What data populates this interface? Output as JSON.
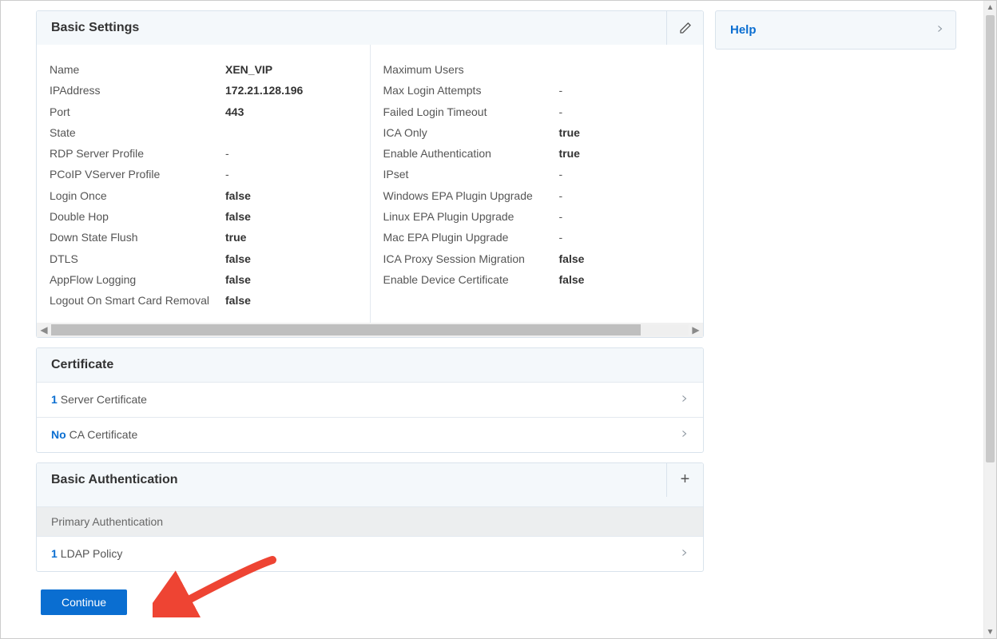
{
  "side": {
    "help_label": "Help"
  },
  "basic_settings": {
    "title": "Basic Settings",
    "left": [
      {
        "label": "Name",
        "value": "XEN_VIP",
        "bold": true
      },
      {
        "label": "IPAddress",
        "value": "172.21.128.196",
        "bold": true
      },
      {
        "label": "Port",
        "value": "443",
        "bold": true
      },
      {
        "label": "State",
        "value": "",
        "bold": false
      },
      {
        "label": "RDP Server Profile",
        "value": "-",
        "bold": false
      },
      {
        "label": "PCoIP VServer Profile",
        "value": "-",
        "bold": false
      },
      {
        "label": "Login Once",
        "value": "false",
        "bold": true
      },
      {
        "label": "Double Hop",
        "value": "false",
        "bold": true
      },
      {
        "label": "Down State Flush",
        "value": "true",
        "bold": true
      },
      {
        "label": "DTLS",
        "value": "false",
        "bold": true
      },
      {
        "label": "AppFlow Logging",
        "value": "false",
        "bold": true
      },
      {
        "label": "Logout On Smart Card Removal",
        "value": "false",
        "bold": true
      }
    ],
    "right": [
      {
        "label": "Maximum Users",
        "value": "",
        "bold": false
      },
      {
        "label": "Max Login Attempts",
        "value": "-",
        "bold": false
      },
      {
        "label": "Failed Login Timeout",
        "value": "-",
        "bold": false
      },
      {
        "label": "ICA Only",
        "value": "true",
        "bold": true
      },
      {
        "label": "Enable Authentication",
        "value": "true",
        "bold": true
      },
      {
        "label": "IPset",
        "value": "-",
        "bold": false
      },
      {
        "label": "Windows EPA Plugin Upgrade",
        "value": "-",
        "bold": false
      },
      {
        "label": "Linux EPA Plugin Upgrade",
        "value": "-",
        "bold": false
      },
      {
        "label": "Mac EPA Plugin Upgrade",
        "value": "-",
        "bold": false
      },
      {
        "label": "ICA Proxy Session Migration",
        "value": "false",
        "bold": true
      },
      {
        "label": "Enable Device Certificate",
        "value": "false",
        "bold": true
      }
    ]
  },
  "certificate": {
    "title": "Certificate",
    "rows": [
      {
        "lead": "1",
        "label": "Server Certificate"
      },
      {
        "lead": "No",
        "label": "CA Certificate"
      }
    ]
  },
  "basic_auth": {
    "title": "Basic Authentication",
    "sub_header": "Primary Authentication",
    "rows": [
      {
        "lead": "1",
        "label": "LDAP Policy"
      }
    ]
  },
  "buttons": {
    "continue": "Continue"
  }
}
